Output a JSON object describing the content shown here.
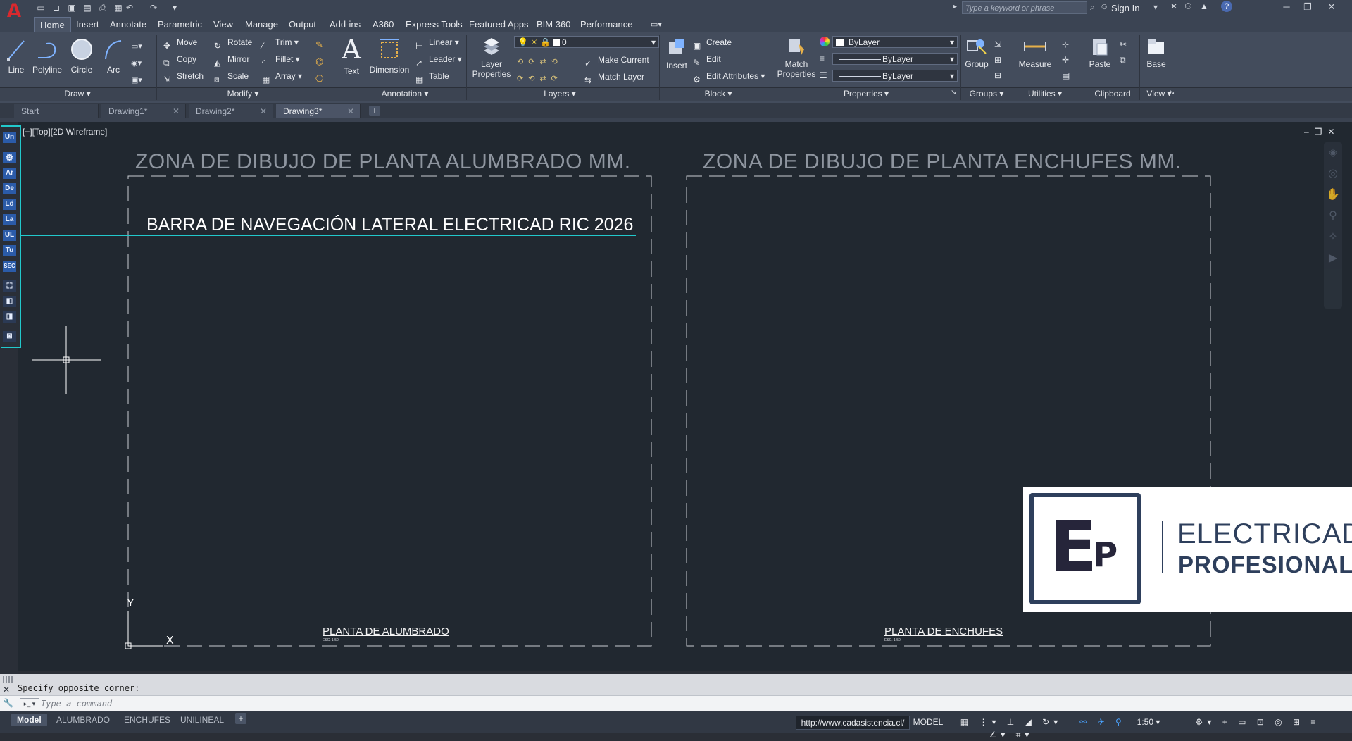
{
  "app": {
    "logo_letter": "A",
    "title": "",
    "search_placeholder": "Type a keyword or phrase",
    "sign_in": "Sign In"
  },
  "menu_tabs": [
    "Home",
    "Insert",
    "Annotate",
    "Parametric",
    "View",
    "Manage",
    "Output",
    "Add-ins",
    "A360",
    "Express Tools",
    "Featured Apps",
    "BIM 360",
    "Performance"
  ],
  "ribbon": {
    "draw": {
      "title": "Draw",
      "tools": [
        "Line",
        "Polyline",
        "Circle",
        "Arc"
      ]
    },
    "modify": {
      "title": "Modify",
      "rows": [
        [
          "Move",
          "Rotate",
          "Trim"
        ],
        [
          "Copy",
          "Mirror",
          "Fillet"
        ],
        [
          "Stretch",
          "Scale",
          "Array"
        ]
      ]
    },
    "annotation": {
      "title": "Annotation",
      "text": "Text",
      "dimension": "Dimension",
      "small": [
        "Linear",
        "Leader",
        "Table"
      ]
    },
    "layers": {
      "title": "Layers",
      "layer_properties": "Layer Properties",
      "current_layer": "0",
      "make_current": "Make Current",
      "match_layer": "Match Layer"
    },
    "block": {
      "title": "Block",
      "insert": "Insert",
      "create": "Create",
      "edit": "Edit",
      "edit_attributes": "Edit Attributes"
    },
    "properties": {
      "title": "Properties",
      "match_properties": "Match Properties",
      "color": "ByLayer",
      "linetype": "ByLayer",
      "lineweight": "ByLayer"
    },
    "groups": {
      "title": "Groups",
      "group": "Group"
    },
    "utilities": {
      "title": "Utilities",
      "measure": "Measure"
    },
    "clipboard": {
      "title": "Clipboard",
      "paste": "Paste"
    },
    "view": {
      "title": "View",
      "base": "Base"
    }
  },
  "doc_tabs": [
    "Start",
    "Drawing1*",
    "Drawing2*",
    "Drawing3*"
  ],
  "viewport_label": "[−][Top][2D Wireframe]",
  "sidebar_buttons": [
    "Un",
    "⚙",
    "Ar",
    "De",
    "Ld",
    "La",
    "UL",
    "Tu",
    "SEC"
  ],
  "drawing": {
    "zone_left_title": "ZONA DE DIBUJO DE PLANTA ALUMBRADO MM.",
    "zone_right_title": "ZONA DE DIBUJO DE PLANTA ENCHUFES MM.",
    "nav_label": "BARRA DE NAVEGACIÓN LATERAL ELECTRICAD RIC 2026",
    "plan_left": "PLANTA DE ALUMBRADO",
    "plan_right": "PLANTA DE ENCHUFES",
    "scale_note": "ESC. 1:50",
    "ucs_x": "X",
    "ucs_y": "Y"
  },
  "brand": {
    "initial_big": "E",
    "initial_small": "P",
    "line1": "ELECTRICAD",
    "line2": "PROFESIONAL"
  },
  "command": {
    "history": "Specify opposite corner:",
    "placeholder": "Type a command"
  },
  "layout_tabs": [
    "Model",
    "ALUMBRADO",
    "ENCHUFES",
    "UNILINEAL"
  ],
  "status": {
    "url": "http://www.cadasistencia.cl/",
    "space": "MODEL",
    "scale": "1:50"
  },
  "colors": {
    "accent_cyan": "#22c9cc",
    "canvas_bg": "#212830",
    "autocad_red": "#d9292e",
    "brand_navy": "#2e3f5c"
  }
}
